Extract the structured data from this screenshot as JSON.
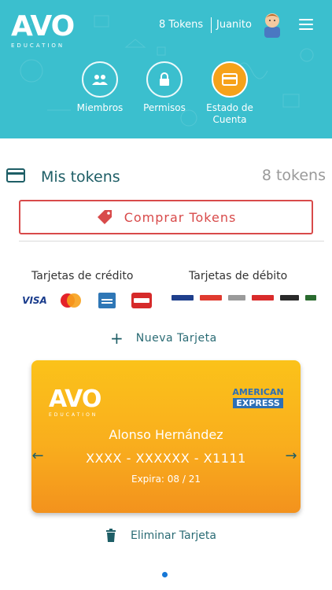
{
  "header": {
    "logo_text": "AVO",
    "logo_subtext": "EDUCATION",
    "tokens_label": "8 Tokens",
    "user_name": "Juanito",
    "accent_color": "#3bbfce"
  },
  "nav": {
    "items": [
      {
        "label": "Miembros",
        "icon": "people-icon"
      },
      {
        "label": "Permisos",
        "icon": "lock-icon"
      },
      {
        "label": "Estado de Cuenta",
        "icon": "credit-card-icon",
        "active": true
      }
    ]
  },
  "tokens_section": {
    "title": "Mis tokens",
    "count": "8 tokens",
    "buy_button_label": "Comprar Tokens"
  },
  "payment_methods": {
    "credit_header": "Tarjetas de crédito",
    "debit_header": "Tarjetas de débito",
    "credit_brands": [
      "VISA",
      "MasterCard",
      "American Express",
      "Carnet"
    ],
    "debit_banks": [
      "Banamex",
      "Santander",
      "HSBC",
      "Scotiabank",
      "Inbursa",
      "Ixe"
    ]
  },
  "new_card_label": "Nueva Tarjeta",
  "card": {
    "brand": "American Express",
    "brand_line1": "AMERICAN",
    "brand_line2": "EXPRESS",
    "logo_text": "AVO",
    "logo_subtext": "EDUCATION",
    "holder": "Alonso Hernández",
    "number": "XXXX - XXXXXX - X1111",
    "expiry": "Expira: 08 / 21"
  },
  "delete_card_label": "Eliminar Tarjeta",
  "carousel": {
    "pages": 1,
    "current": 1
  }
}
